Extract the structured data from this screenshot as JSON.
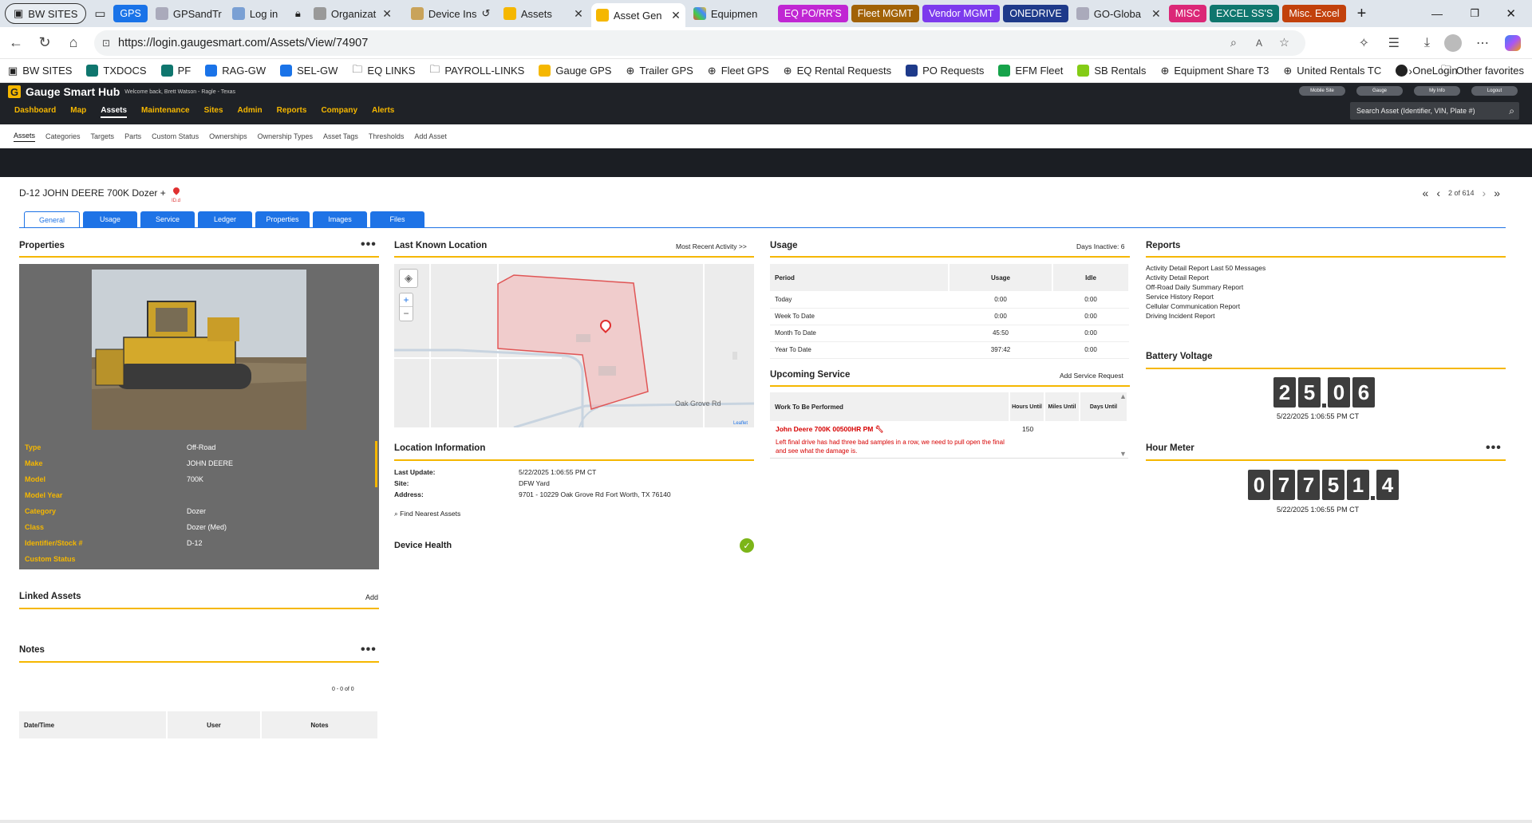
{
  "browser": {
    "tabs": [
      {
        "label": "BW SITES",
        "kind": "group"
      },
      {
        "label": "GPS",
        "color": "#1a73e8",
        "kind": "pill"
      },
      {
        "label": "GPSandTr",
        "kind": "tab"
      },
      {
        "label": "Log in",
        "kind": "tab"
      },
      {
        "label": "Organizat",
        "kind": "tab"
      },
      {
        "label": "Device Ins",
        "kind": "tab"
      },
      {
        "label": "Assets",
        "kind": "tab"
      },
      {
        "label": "Asset Gen",
        "kind": "active"
      },
      {
        "label": "Equipmen",
        "kind": "tab"
      },
      {
        "label": "EQ PO/RR'S",
        "color": "#c026d3",
        "kind": "pill"
      },
      {
        "label": "Fleet MGMT",
        "color": "#a16207",
        "kind": "pill"
      },
      {
        "label": "Vendor MGMT",
        "color": "#7c3aed",
        "kind": "pill"
      },
      {
        "label": "ONEDRIVE",
        "color": "#1e3a8a",
        "kind": "pill"
      },
      {
        "label": "GO-Globa",
        "kind": "tab"
      },
      {
        "label": "MISC",
        "color": "#db2777",
        "kind": "pill"
      },
      {
        "label": "EXCEL SS'S",
        "color": "#0f766e",
        "kind": "pill"
      },
      {
        "label": "Misc. Excel",
        "color": "#c2410c",
        "kind": "pill"
      }
    ],
    "url": "https://login.gaugesmart.com/Assets/View/74907",
    "bookmarks": [
      "BW SITES",
      "TXDOCS",
      "PF",
      "RAG-GW",
      "SEL-GW",
      "EQ LINKS",
      "PAYROLL-LINKS",
      "Gauge GPS",
      "Trailer GPS",
      "Fleet GPS",
      "EQ Rental Requests",
      "PO Requests",
      "EFM Fleet",
      "SB Rentals",
      "Equipment Share T3",
      "United Rentals TC",
      "OneLogin"
    ],
    "other_favorites": "Other favorites"
  },
  "app": {
    "brand": "Gauge Smart Hub",
    "welcome": "Welcome back, Brett Watson - Ragle - Texas",
    "nav": [
      "Dashboard",
      "Map",
      "Assets",
      "Maintenance",
      "Sites",
      "Admin",
      "Reports",
      "Company",
      "Alerts"
    ],
    "active_nav": "Assets",
    "top_buttons": [
      "Mobile Site",
      "Gauge",
      "My Info",
      "Logout"
    ],
    "search_placeholder": "Search Asset (Identifier, VIN, Plate #)",
    "subnav": [
      "Assets",
      "Categories",
      "Targets",
      "Parts",
      "Custom Status",
      "Ownerships",
      "Ownership Types",
      "Asset Tags",
      "Thresholds",
      "Add Asset"
    ]
  },
  "asset": {
    "title": "D-12 JOHN DEERE 700K Dozer +",
    "tag_text": "ID.d",
    "pager": "2 of 614",
    "tabs": [
      "General",
      "Usage",
      "Service",
      "Ledger",
      "Properties",
      "Images",
      "Files"
    ]
  },
  "properties": {
    "title": "Properties",
    "rows": [
      {
        "label": "Type",
        "value": "Off-Road"
      },
      {
        "label": "Make",
        "value": "JOHN DEERE"
      },
      {
        "label": "Model",
        "value": "700K"
      },
      {
        "label": "Model Year",
        "value": ""
      },
      {
        "label": "Category",
        "value": "Dozer"
      },
      {
        "label": "Class",
        "value": "Dozer (Med)"
      },
      {
        "label": "Identifier/Stock #",
        "value": "D-12"
      },
      {
        "label": "Custom Status",
        "value": ""
      }
    ]
  },
  "linked_assets": {
    "title": "Linked Assets",
    "add": "Add"
  },
  "notes": {
    "title": "Notes",
    "count": "0 - 0 of 0",
    "columns": [
      "Date/Time",
      "User",
      "Notes"
    ]
  },
  "location": {
    "title": "Last Known Location",
    "recent_link": "Most Recent Activity >>",
    "road_label": "Oak Grove Rd",
    "attribution": "Leaflet",
    "info_title": "Location Information",
    "last_update_label": "Last Update:",
    "last_update": "5/22/2025 1:06:55 PM CT",
    "site_label": "Site:",
    "site": "DFW Yard",
    "address_label": "Address:",
    "address": "9701 - 10229 Oak Grove Rd Fort Worth, TX 76140",
    "nearest": "Find Nearest Assets",
    "device_health": "Device Health"
  },
  "usage": {
    "title": "Usage",
    "days_inactive": "Days Inactive: 6",
    "columns": [
      "Period",
      "Usage",
      "Idle"
    ],
    "rows": [
      [
        "Today",
        "0:00",
        "0:00"
      ],
      [
        "Week To Date",
        "0:00",
        "0:00"
      ],
      [
        "Month To Date",
        "45:50",
        "0:00"
      ],
      [
        "Year To Date",
        "397:42",
        "0:00"
      ]
    ]
  },
  "service": {
    "title": "Upcoming Service",
    "add_link": "Add Service Request",
    "columns": [
      "Work To Be Performed",
      "Hours Until",
      "Miles Until",
      "Days Until"
    ],
    "item_title": "John Deere 700K 00500HR PM",
    "item_hours": "150",
    "item_note": "Left final drive has had three bad samples in a row, we need to pull open the final and see what the damage is."
  },
  "reports": {
    "title": "Reports",
    "links": [
      "Activity Detail Report Last 50 Messages",
      "Activity Detail Report",
      "Off-Road Daily Summary Report",
      "Service History Report",
      "Cellular Communication Report",
      "Driving Incident Report"
    ]
  },
  "battery": {
    "title": "Battery Voltage",
    "digits": [
      "2",
      "5",
      "0",
      "6"
    ],
    "timestamp": "5/22/2025 1:06:55 PM CT"
  },
  "hour_meter": {
    "title": "Hour Meter",
    "digits": [
      "0",
      "7",
      "7",
      "5",
      "1",
      "4"
    ],
    "timestamp": "5/22/2025 1:06:55 PM CT"
  }
}
